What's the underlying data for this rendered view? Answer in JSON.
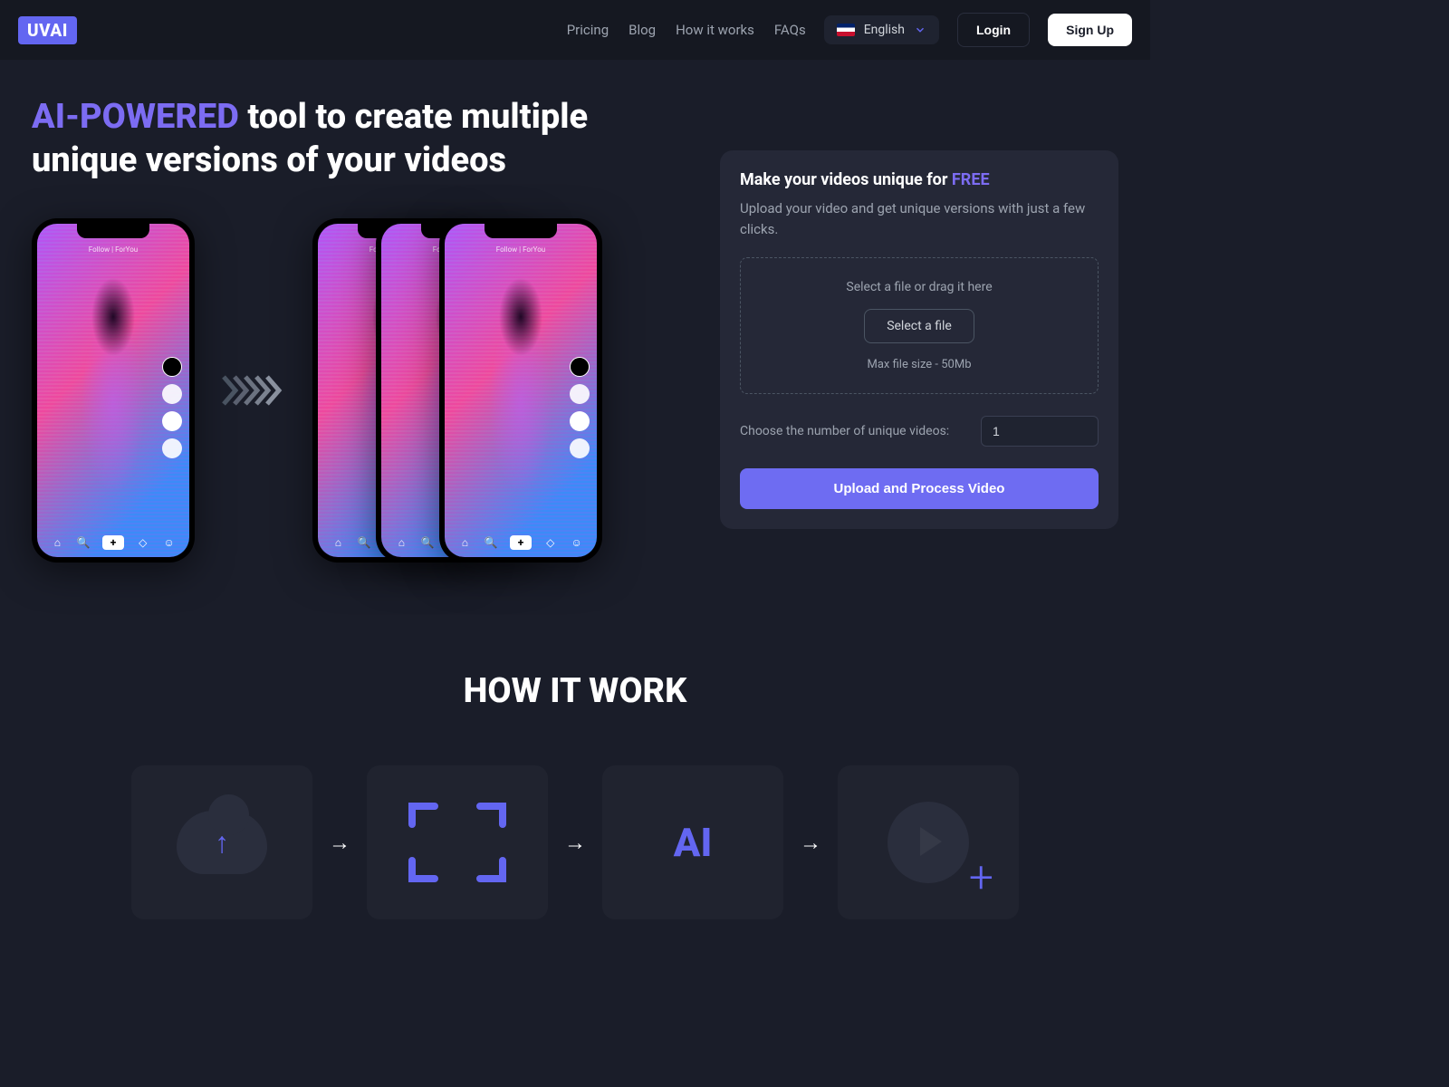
{
  "brand": "UVAI",
  "nav": {
    "links": [
      "Pricing",
      "Blog",
      "How it works",
      "FAQs"
    ],
    "language": "English",
    "login": "Login",
    "signup": "Sign Up"
  },
  "hero": {
    "title_accent": "AI-POWERED",
    "title_rest": " tool to create multiple unique versions of your videos",
    "phone_top_text": "Follow | ForYou"
  },
  "upload": {
    "title_prefix": "Make your videos unique for ",
    "title_free": "FREE",
    "subtitle": "Upload your video and get unique versions with just a few clicks.",
    "dz_text": "Select a file or drag it here",
    "dz_button": "Select a file",
    "dz_max": "Max file size - 50Mb",
    "count_label": "Choose the number of unique videos:",
    "count_value": "1",
    "process_button": "Upload and Process Video"
  },
  "how": {
    "title": "HOW IT WORK",
    "ai_label": "AI"
  }
}
